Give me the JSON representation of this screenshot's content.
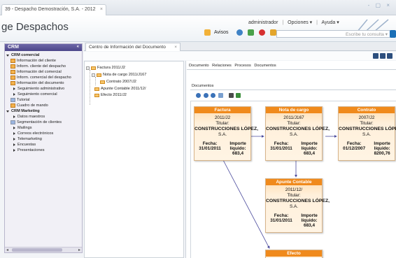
{
  "browser": {
    "tab_title": "39 - Despacho Demostración, S.A. - 2012",
    "tab_close": "×",
    "window_controls": "- ▢ ×"
  },
  "header": {
    "title": "ge Despachos",
    "user": "administrador",
    "options": "Opciones ▾",
    "help": "Ayuda ▾",
    "separator": "|",
    "avisos": "Avisos",
    "search_placeholder": "Escribe tu consulta ▾"
  },
  "sidebar": {
    "title": "CRM",
    "collapse": "«",
    "items": [
      {
        "label": "CRM comercial"
      },
      {
        "label": "Información del cliente"
      },
      {
        "label": "Inform. cliente del despacho"
      },
      {
        "label": "Información del comercial"
      },
      {
        "label": "Inform. comercial del despacho"
      },
      {
        "label": "Información del documento"
      },
      {
        "label": "Seguimiento administrativo"
      },
      {
        "label": "Seguimiento comercial"
      },
      {
        "label": "Tutorial"
      },
      {
        "label": "Cuadro de mando"
      },
      {
        "label": "CRM Marketing"
      },
      {
        "label": "Datos maestros"
      },
      {
        "label": "Segmentación de clientes"
      },
      {
        "label": "Mailings"
      },
      {
        "label": "Correos electrónicos"
      },
      {
        "label": "Telemarketing"
      },
      {
        "label": "Encuestas"
      },
      {
        "label": "Presentaciones"
      }
    ],
    "scroll_left": "◂",
    "scroll_right": "▸"
  },
  "main": {
    "tab_title": "Centro de Información del Documento",
    "tab_close": "×"
  },
  "tree": {
    "nodes": [
      {
        "label": "Factura 2011/J2"
      },
      {
        "label": "Nota de cargo 2011/J167"
      },
      {
        "label": "Contrato 2007/J2"
      },
      {
        "label": "Apunte Contable 2011/12/"
      },
      {
        "label": "Efecto 2011/J2"
      }
    ]
  },
  "detail": {
    "menu": [
      "Documento",
      "Relaciones",
      "Procesos",
      "Documentos"
    ],
    "documents_label": "Documentos"
  },
  "cards": {
    "factura": {
      "type": "Factura",
      "number": "2011/J2",
      "titular_label": "Titular:",
      "company": "CONSTRUCCIONES LÓPEZ,",
      "company2": "S.A.",
      "fecha_label": "Fecha:",
      "fecha": "31/01/2011",
      "importe_label": "Importe",
      "liquido_label": "líquido:",
      "importe": "683,4"
    },
    "nota": {
      "type": "Nota de cargo",
      "number": "2011/J167",
      "titular_label": "Titular:",
      "company": "CONSTRUCCIONES LÓPEZ,",
      "company2": "S.A.",
      "fecha_label": "Fecha:",
      "fecha": "31/01/2011",
      "importe_label": "Importe",
      "liquido_label": "líquido:",
      "importe": "683,4"
    },
    "contrato": {
      "type": "Contrato",
      "number": "2007/J2",
      "titular_label": "Titular:",
      "company": "CONSTRUCCIONES LÓPEZ,",
      "company2": "S.A.",
      "fecha_label": "Fecha:",
      "fecha": "01/12/2007",
      "importe_label": "Importe",
      "liquido_label": "líquido:",
      "importe": "8200,76"
    },
    "apunte": {
      "type": "Apunte Contable",
      "number": "2011/12/",
      "titular_label": "Titular:",
      "company": "CONSTRUCCIONES LÓPEZ,",
      "company2": "S.A.",
      "fecha_label": "Fecha:",
      "fecha": "31/01/2011",
      "importe_label": "Importe",
      "liquido_label": "líquido:",
      "importe": "683,4"
    },
    "efecto": {
      "type": "Efecto"
    }
  },
  "colors": {
    "card_header": "#f08a1c",
    "connector": "#4a4aa8",
    "sidebar_header": "#5a5498"
  }
}
